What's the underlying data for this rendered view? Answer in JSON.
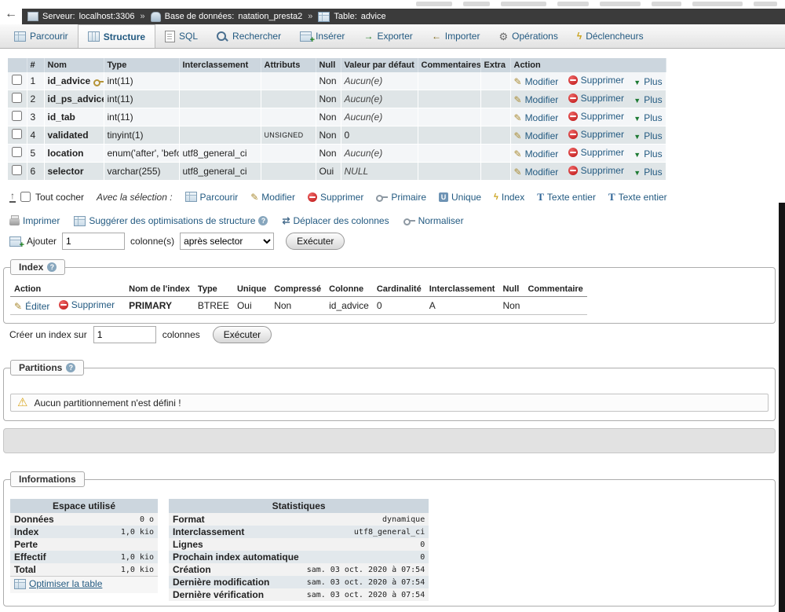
{
  "colors": {
    "link": "#235a81",
    "breadcrumb_bg": "#3b3b3b",
    "table_header_bg": "#ccd6de",
    "row_even_bg": "#dfe5e7",
    "row_odd_bg": "#f4f6f8",
    "delete_red": "#bb1111",
    "warning_orange": "#d9a621"
  },
  "browser": {
    "back_label": "←"
  },
  "breadcrumb": {
    "sep": "»",
    "server_label": "Serveur:",
    "server_value": "localhost:3306",
    "db_label": "Base de données:",
    "db_value": "natation_presta2",
    "table_label": "Table:",
    "table_value": "advice"
  },
  "tabs": [
    {
      "label": "Parcourir"
    },
    {
      "label": "Structure"
    },
    {
      "label": "SQL"
    },
    {
      "label": "Rechercher"
    },
    {
      "label": "Insérer"
    },
    {
      "label": "Exporter"
    },
    {
      "label": "Importer"
    },
    {
      "label": "Opérations"
    },
    {
      "label": "Déclencheurs"
    }
  ],
  "structure": {
    "headers": [
      "#",
      "Nom",
      "Type",
      "Interclassement",
      "Attributs",
      "Null",
      "Valeur par défaut",
      "Commentaires",
      "Extra",
      "Action"
    ],
    "action_labels": {
      "modify": "Modifier",
      "drop": "Supprimer",
      "more": "Plus"
    },
    "rows": [
      {
        "num": "1",
        "name": "id_advice",
        "type": "int(11)",
        "collation": "",
        "attributes": "",
        "null": "Non",
        "default": "Aucun(e)",
        "comments": "",
        "extra": ""
      },
      {
        "num": "2",
        "name": "id_ps_advice",
        "type": "int(11)",
        "collation": "",
        "attributes": "",
        "null": "Non",
        "default": "Aucun(e)",
        "comments": "",
        "extra": ""
      },
      {
        "num": "3",
        "name": "id_tab",
        "type": "int(11)",
        "collation": "",
        "attributes": "",
        "null": "Non",
        "default": "Aucun(e)",
        "comments": "",
        "extra": ""
      },
      {
        "num": "4",
        "name": "validated",
        "type": "tinyint(1)",
        "collation": "",
        "attributes": "UNSIGNED",
        "null": "Non",
        "default": "0",
        "comments": "",
        "extra": ""
      },
      {
        "num": "5",
        "name": "location",
        "type": "enum('after', 'before')",
        "collation": "utf8_general_ci",
        "attributes": "",
        "null": "Non",
        "default": "Aucun(e)",
        "comments": "",
        "extra": ""
      },
      {
        "num": "6",
        "name": "selector",
        "type": "varchar(255)",
        "collation": "utf8_general_ci",
        "attributes": "",
        "null": "Oui",
        "default": "NULL",
        "comments": "",
        "extra": ""
      }
    ]
  },
  "selection": {
    "check_all": "Tout cocher",
    "with_selected": "Avec la sélection :",
    "actions": [
      {
        "label": "Parcourir"
      },
      {
        "label": "Modifier"
      },
      {
        "label": "Supprimer"
      },
      {
        "label": "Primaire"
      },
      {
        "label": "Unique"
      },
      {
        "label": "Index"
      },
      {
        "label": "Texte entier"
      },
      {
        "label": "Texte entier"
      }
    ]
  },
  "tools": {
    "print": "Imprimer",
    "propose": "Suggérer des optimisations de structure",
    "move_columns": "Déplacer des colonnes",
    "normalize": "Normaliser"
  },
  "add_column": {
    "add_label": "Ajouter",
    "count_value": "1",
    "columns_label": "colonne(s)",
    "position_selected": "après selector",
    "execute_label": "Exécuter"
  },
  "index_section": {
    "legend": "Index",
    "headers": [
      "Action",
      "Nom de l'index",
      "Type",
      "Unique",
      "Compressé",
      "Colonne",
      "Cardinalité",
      "Interclassement",
      "Null",
      "Commentaire"
    ],
    "edit_label": "Éditer",
    "drop_label": "Supprimer",
    "row": {
      "name": "PRIMARY",
      "type": "BTREE",
      "unique": "Oui",
      "packed": "Non",
      "column": "id_advice",
      "cardinality": "0",
      "collation": "A",
      "null": "Non",
      "comment": ""
    },
    "create_label": "Créer un index sur",
    "create_count": "1",
    "create_columns_label": "colonnes",
    "execute_label": "Exécuter"
  },
  "partitions_section": {
    "legend": "Partitions",
    "warning": "Aucun partitionnement n'est défini !"
  },
  "info_section": {
    "legend": "Informations",
    "space": {
      "title": "Espace utilisé",
      "rows": [
        {
          "label": "Données",
          "value": "0 o"
        },
        {
          "label": "Index",
          "value": "1,0 kio"
        },
        {
          "label": "Perte",
          "value": ""
        },
        {
          "label": "Effectif",
          "value": "1,0 kio"
        },
        {
          "label": "Total",
          "value": "1,0 kio"
        }
      ],
      "optimize_label": "Optimiser la table"
    },
    "stats": {
      "title": "Statistiques",
      "rows": [
        {
          "label": "Format",
          "value": "dynamique"
        },
        {
          "label": "Interclassement",
          "value": "utf8_general_ci"
        },
        {
          "label": "Lignes",
          "value": "0"
        },
        {
          "label": "Prochain index automatique",
          "value": "0"
        },
        {
          "label": "Création",
          "value": "sam. 03 oct. 2020 à 07:54"
        },
        {
          "label": "Dernière modification",
          "value": "sam. 03 oct. 2020 à 07:54"
        },
        {
          "label": "Dernière vérification",
          "value": "sam. 03 oct. 2020 à 07:54"
        }
      ]
    }
  }
}
